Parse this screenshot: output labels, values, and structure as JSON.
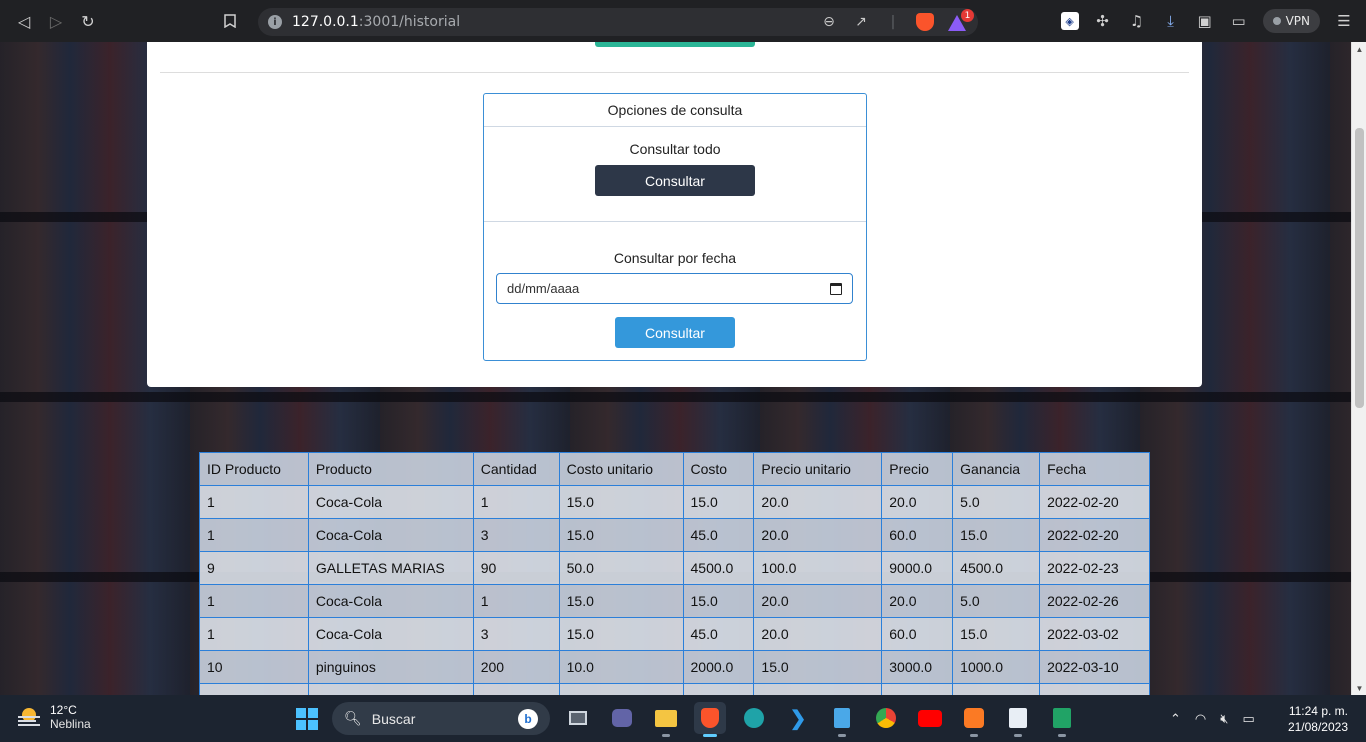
{
  "browser": {
    "url_host": "127.0.0.1",
    "url_rest": ":3001/historial",
    "vpn_label": "VPN",
    "rewards_badge": "1"
  },
  "options": {
    "title": "Opciones de consulta",
    "all_label": "Consultar todo",
    "all_button": "Consultar",
    "date_label": "Consultar por fecha",
    "date_placeholder": "dd/mm/aaaa",
    "date_button": "Consultar"
  },
  "table": {
    "headers": [
      "ID Producto",
      "Producto",
      "Cantidad",
      "Costo unitario",
      "Costo",
      "Precio unitario",
      "Precio",
      "Ganancia",
      "Fecha"
    ],
    "rows": [
      [
        "1",
        "Coca-Cola",
        "1",
        "15.0",
        "15.0",
        "20.0",
        "20.0",
        "5.0",
        "2022-02-20"
      ],
      [
        "1",
        "Coca-Cola",
        "3",
        "15.0",
        "45.0",
        "20.0",
        "60.0",
        "15.0",
        "2022-02-20"
      ],
      [
        "9",
        "GALLETAS MARIAS",
        "90",
        "50.0",
        "4500.0",
        "100.0",
        "9000.0",
        "4500.0",
        "2022-02-23"
      ],
      [
        "1",
        "Coca-Cola",
        "1",
        "15.0",
        "15.0",
        "20.0",
        "20.0",
        "5.0",
        "2022-02-26"
      ],
      [
        "1",
        "Coca-Cola",
        "3",
        "15.0",
        "45.0",
        "20.0",
        "60.0",
        "15.0",
        "2022-03-02"
      ],
      [
        "10",
        "pinguinos",
        "200",
        "10.0",
        "2000.0",
        "15.0",
        "3000.0",
        "1000.0",
        "2022-03-10"
      ]
    ]
  },
  "taskbar": {
    "weather_temp": "12°C",
    "weather_desc": "Neblina",
    "search_label": "Buscar",
    "time": "11:24 p. m.",
    "date": "21/08/2023"
  },
  "colors": {
    "dark_button": "#2d3748",
    "blue_button": "#3498db",
    "table_border": "#2b7fd9"
  }
}
